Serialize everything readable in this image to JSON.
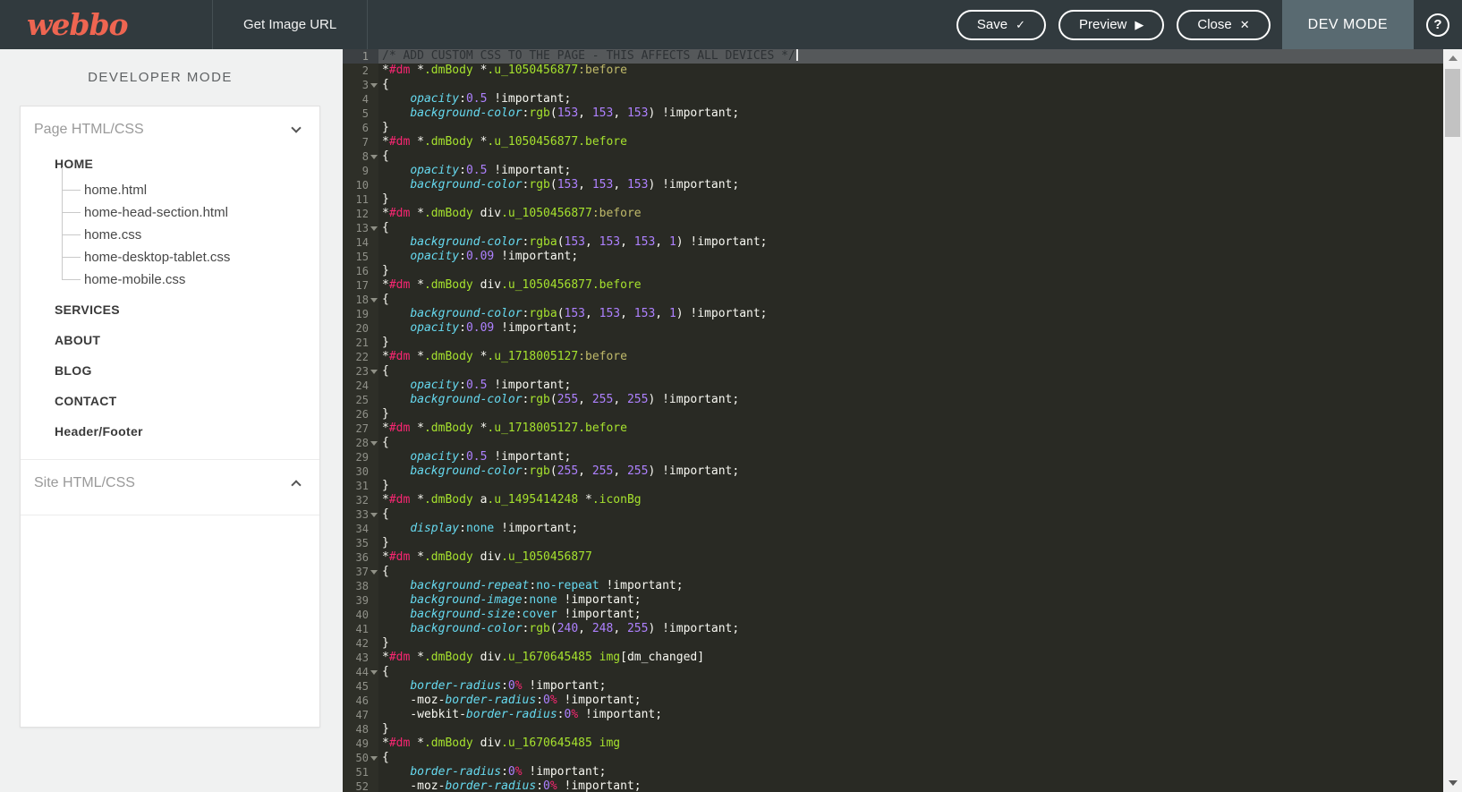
{
  "topbar": {
    "logo": "webbo",
    "get_image_url": "Get Image URL",
    "buttons": [
      {
        "label": "Save",
        "icon": "check-icon",
        "glyph": "✓"
      },
      {
        "label": "Preview",
        "icon": "play-icon",
        "glyph": "▶"
      },
      {
        "label": "Close",
        "icon": "close-icon",
        "glyph": "✕"
      }
    ],
    "dev_mode_label": "DEV MODE",
    "help_glyph": "?"
  },
  "sidebar": {
    "title": "DEVELOPER MODE",
    "page_section_label": "Page HTML/CSS",
    "site_section_label": "Site HTML/CSS",
    "pages": [
      {
        "label": "HOME",
        "files": [
          "home.html",
          "home-head-section.html",
          "home.css",
          "home-desktop-tablet.css",
          "home-mobile.css"
        ]
      },
      {
        "label": "SERVICES",
        "files": []
      },
      {
        "label": "ABOUT",
        "files": []
      },
      {
        "label": "BLOG",
        "files": []
      },
      {
        "label": "CONTACT",
        "files": []
      },
      {
        "label": "Header/Footer",
        "files": []
      }
    ]
  },
  "palette": {
    "brand_orange": "#ee6551",
    "topbar_bg": "#313a3e",
    "devtab_bg": "#596a71",
    "editor_bg": "#292a24",
    "selection_bg": "#55585a",
    "token_white": "#f8f8f2",
    "token_pink": "#f92672",
    "token_green": "#a6e22e",
    "token_olive": "#c0ba6a",
    "token_cyan": "#66d9ef",
    "token_purple": "#ae81ff"
  },
  "editor": {
    "lines": [
      {
        "sel": true,
        "caret": true,
        "t": [
          [
            "c",
            "/* ADD CUSTOM CSS TO THE PAGE - THIS AFFECTS ALL DEVICES */"
          ]
        ]
      },
      {
        "t": [
          [
            "w",
            "*"
          ],
          [
            "p",
            "#dm"
          ],
          [
            "w",
            " *"
          ],
          [
            "g",
            ".dmBody"
          ],
          [
            "w",
            " *"
          ],
          [
            "g",
            ".u_1050456877"
          ],
          [
            "o",
            ":before"
          ]
        ]
      },
      {
        "f": true,
        "t": [
          [
            "w",
            "{"
          ]
        ]
      },
      {
        "t": [
          [
            "w",
            "    "
          ],
          [
            "b",
            "opacity"
          ],
          [
            "w",
            ":"
          ],
          [
            "n",
            "0.5"
          ],
          [
            "w",
            " !important;"
          ]
        ]
      },
      {
        "t": [
          [
            "w",
            "    "
          ],
          [
            "b",
            "background-color"
          ],
          [
            "w",
            ":"
          ],
          [
            "g",
            "rgb"
          ],
          [
            "w",
            "("
          ],
          [
            "n",
            "153"
          ],
          [
            "w",
            ", "
          ],
          [
            "n",
            "153"
          ],
          [
            "w",
            ", "
          ],
          [
            "n",
            "153"
          ],
          [
            "w",
            ") !important;"
          ]
        ]
      },
      {
        "t": [
          [
            "w",
            "}"
          ]
        ]
      },
      {
        "t": [
          [
            "w",
            "*"
          ],
          [
            "p",
            "#dm"
          ],
          [
            "w",
            " *"
          ],
          [
            "g",
            ".dmBody"
          ],
          [
            "w",
            " *"
          ],
          [
            "g",
            ".u_1050456877.before"
          ]
        ]
      },
      {
        "f": true,
        "t": [
          [
            "w",
            "{"
          ]
        ]
      },
      {
        "t": [
          [
            "w",
            "    "
          ],
          [
            "b",
            "opacity"
          ],
          [
            "w",
            ":"
          ],
          [
            "n",
            "0.5"
          ],
          [
            "w",
            " !important;"
          ]
        ]
      },
      {
        "t": [
          [
            "w",
            "    "
          ],
          [
            "b",
            "background-color"
          ],
          [
            "w",
            ":"
          ],
          [
            "g",
            "rgb"
          ],
          [
            "w",
            "("
          ],
          [
            "n",
            "153"
          ],
          [
            "w",
            ", "
          ],
          [
            "n",
            "153"
          ],
          [
            "w",
            ", "
          ],
          [
            "n",
            "153"
          ],
          [
            "w",
            ") !important;"
          ]
        ]
      },
      {
        "t": [
          [
            "w",
            "}"
          ]
        ]
      },
      {
        "t": [
          [
            "w",
            "*"
          ],
          [
            "p",
            "#dm"
          ],
          [
            "w",
            " *"
          ],
          [
            "g",
            ".dmBody"
          ],
          [
            "w",
            " div"
          ],
          [
            "g",
            ".u_1050456877"
          ],
          [
            "o",
            ":before"
          ]
        ]
      },
      {
        "f": true,
        "t": [
          [
            "w",
            "{"
          ]
        ]
      },
      {
        "t": [
          [
            "w",
            "    "
          ],
          [
            "b",
            "background-color"
          ],
          [
            "w",
            ":"
          ],
          [
            "g",
            "rgba"
          ],
          [
            "w",
            "("
          ],
          [
            "n",
            "153"
          ],
          [
            "w",
            ", "
          ],
          [
            "n",
            "153"
          ],
          [
            "w",
            ", "
          ],
          [
            "n",
            "153"
          ],
          [
            "w",
            ", "
          ],
          [
            "n",
            "1"
          ],
          [
            "w",
            ") !important;"
          ]
        ]
      },
      {
        "t": [
          [
            "w",
            "    "
          ],
          [
            "b",
            "opacity"
          ],
          [
            "w",
            ":"
          ],
          [
            "n",
            "0.09"
          ],
          [
            "w",
            " !important;"
          ]
        ]
      },
      {
        "t": [
          [
            "w",
            "}"
          ]
        ]
      },
      {
        "t": [
          [
            "w",
            "*"
          ],
          [
            "p",
            "#dm"
          ],
          [
            "w",
            " *"
          ],
          [
            "g",
            ".dmBody"
          ],
          [
            "w",
            " div"
          ],
          [
            "g",
            ".u_1050456877.before"
          ]
        ]
      },
      {
        "f": true,
        "t": [
          [
            "w",
            "{"
          ]
        ]
      },
      {
        "t": [
          [
            "w",
            "    "
          ],
          [
            "b",
            "background-color"
          ],
          [
            "w",
            ":"
          ],
          [
            "g",
            "rgba"
          ],
          [
            "w",
            "("
          ],
          [
            "n",
            "153"
          ],
          [
            "w",
            ", "
          ],
          [
            "n",
            "153"
          ],
          [
            "w",
            ", "
          ],
          [
            "n",
            "153"
          ],
          [
            "w",
            ", "
          ],
          [
            "n",
            "1"
          ],
          [
            "w",
            ") !important;"
          ]
        ]
      },
      {
        "t": [
          [
            "w",
            "    "
          ],
          [
            "b",
            "opacity"
          ],
          [
            "w",
            ":"
          ],
          [
            "n",
            "0.09"
          ],
          [
            "w",
            " !important;"
          ]
        ]
      },
      {
        "t": [
          [
            "w",
            "}"
          ]
        ]
      },
      {
        "t": [
          [
            "w",
            "*"
          ],
          [
            "p",
            "#dm"
          ],
          [
            "w",
            " *"
          ],
          [
            "g",
            ".dmBody"
          ],
          [
            "w",
            " *"
          ],
          [
            "g",
            ".u_1718005127"
          ],
          [
            "o",
            ":before"
          ]
        ]
      },
      {
        "f": true,
        "t": [
          [
            "w",
            "{"
          ]
        ]
      },
      {
        "t": [
          [
            "w",
            "    "
          ],
          [
            "b",
            "opacity"
          ],
          [
            "w",
            ":"
          ],
          [
            "n",
            "0.5"
          ],
          [
            "w",
            " !important;"
          ]
        ]
      },
      {
        "t": [
          [
            "w",
            "    "
          ],
          [
            "b",
            "background-color"
          ],
          [
            "w",
            ":"
          ],
          [
            "g",
            "rgb"
          ],
          [
            "w",
            "("
          ],
          [
            "n",
            "255"
          ],
          [
            "w",
            ", "
          ],
          [
            "n",
            "255"
          ],
          [
            "w",
            ", "
          ],
          [
            "n",
            "255"
          ],
          [
            "w",
            ") !important;"
          ]
        ]
      },
      {
        "t": [
          [
            "w",
            "}"
          ]
        ]
      },
      {
        "t": [
          [
            "w",
            "*"
          ],
          [
            "p",
            "#dm"
          ],
          [
            "w",
            " *"
          ],
          [
            "g",
            ".dmBody"
          ],
          [
            "w",
            " *"
          ],
          [
            "g",
            ".u_1718005127.before"
          ]
        ]
      },
      {
        "f": true,
        "t": [
          [
            "w",
            "{"
          ]
        ]
      },
      {
        "t": [
          [
            "w",
            "    "
          ],
          [
            "b",
            "opacity"
          ],
          [
            "w",
            ":"
          ],
          [
            "n",
            "0.5"
          ],
          [
            "w",
            " !important;"
          ]
        ]
      },
      {
        "t": [
          [
            "w",
            "    "
          ],
          [
            "b",
            "background-color"
          ],
          [
            "w",
            ":"
          ],
          [
            "g",
            "rgb"
          ],
          [
            "w",
            "("
          ],
          [
            "n",
            "255"
          ],
          [
            "w",
            ", "
          ],
          [
            "n",
            "255"
          ],
          [
            "w",
            ", "
          ],
          [
            "n",
            "255"
          ],
          [
            "w",
            ") !important;"
          ]
        ]
      },
      {
        "t": [
          [
            "w",
            "}"
          ]
        ]
      },
      {
        "t": [
          [
            "w",
            "*"
          ],
          [
            "p",
            "#dm"
          ],
          [
            "w",
            " *"
          ],
          [
            "g",
            ".dmBody"
          ],
          [
            "w",
            " a"
          ],
          [
            "g",
            ".u_1495414248"
          ],
          [
            "w",
            " *"
          ],
          [
            "g",
            ".iconBg"
          ]
        ]
      },
      {
        "f": true,
        "t": [
          [
            "w",
            "{"
          ]
        ]
      },
      {
        "t": [
          [
            "w",
            "    "
          ],
          [
            "b",
            "display"
          ],
          [
            "w",
            ":"
          ],
          [
            "k",
            "none"
          ],
          [
            "w",
            " !important;"
          ]
        ]
      },
      {
        "t": [
          [
            "w",
            "}"
          ]
        ]
      },
      {
        "t": [
          [
            "w",
            "*"
          ],
          [
            "p",
            "#dm"
          ],
          [
            "w",
            " *"
          ],
          [
            "g",
            ".dmBody"
          ],
          [
            "w",
            " div"
          ],
          [
            "g",
            ".u_1050456877"
          ]
        ]
      },
      {
        "f": true,
        "t": [
          [
            "w",
            "{"
          ]
        ]
      },
      {
        "t": [
          [
            "w",
            "    "
          ],
          [
            "b",
            "background-repeat"
          ],
          [
            "w",
            ":"
          ],
          [
            "k",
            "no-repeat"
          ],
          [
            "w",
            " !important;"
          ]
        ]
      },
      {
        "t": [
          [
            "w",
            "    "
          ],
          [
            "b",
            "background-image"
          ],
          [
            "w",
            ":"
          ],
          [
            "k",
            "none"
          ],
          [
            "w",
            " !important;"
          ]
        ]
      },
      {
        "t": [
          [
            "w",
            "    "
          ],
          [
            "b",
            "background-size"
          ],
          [
            "w",
            ":"
          ],
          [
            "k",
            "cover"
          ],
          [
            "w",
            " !important;"
          ]
        ]
      },
      {
        "t": [
          [
            "w",
            "    "
          ],
          [
            "b",
            "background-color"
          ],
          [
            "w",
            ":"
          ],
          [
            "g",
            "rgb"
          ],
          [
            "w",
            "("
          ],
          [
            "n",
            "240"
          ],
          [
            "w",
            ", "
          ],
          [
            "n",
            "248"
          ],
          [
            "w",
            ", "
          ],
          [
            "n",
            "255"
          ],
          [
            "w",
            ") !important;"
          ]
        ]
      },
      {
        "t": [
          [
            "w",
            "}"
          ]
        ]
      },
      {
        "t": [
          [
            "w",
            "*"
          ],
          [
            "p",
            "#dm"
          ],
          [
            "w",
            " *"
          ],
          [
            "g",
            ".dmBody"
          ],
          [
            "w",
            " div"
          ],
          [
            "g",
            ".u_1670645485"
          ],
          [
            "w",
            " "
          ],
          [
            "g",
            "img"
          ],
          [
            "w",
            "[dm_changed]"
          ]
        ]
      },
      {
        "f": true,
        "t": [
          [
            "w",
            "{"
          ]
        ]
      },
      {
        "t": [
          [
            "w",
            "    "
          ],
          [
            "b",
            "border-radius"
          ],
          [
            "w",
            ":"
          ],
          [
            "n",
            "0"
          ],
          [
            "p",
            "%"
          ],
          [
            "w",
            " !important;"
          ]
        ]
      },
      {
        "t": [
          [
            "w",
            "    -moz-"
          ],
          [
            "b",
            "border-radius"
          ],
          [
            "w",
            ":"
          ],
          [
            "n",
            "0"
          ],
          [
            "p",
            "%"
          ],
          [
            "w",
            " !important;"
          ]
        ]
      },
      {
        "t": [
          [
            "w",
            "    -webkit-"
          ],
          [
            "b",
            "border-radius"
          ],
          [
            "w",
            ":"
          ],
          [
            "n",
            "0"
          ],
          [
            "p",
            "%"
          ],
          [
            "w",
            " !important;"
          ]
        ]
      },
      {
        "t": [
          [
            "w",
            "}"
          ]
        ]
      },
      {
        "t": [
          [
            "w",
            "*"
          ],
          [
            "p",
            "#dm"
          ],
          [
            "w",
            " *"
          ],
          [
            "g",
            ".dmBody"
          ],
          [
            "w",
            " div"
          ],
          [
            "g",
            ".u_1670645485"
          ],
          [
            "w",
            " "
          ],
          [
            "g",
            "img"
          ]
        ]
      },
      {
        "f": true,
        "t": [
          [
            "w",
            "{"
          ]
        ]
      },
      {
        "t": [
          [
            "w",
            "    "
          ],
          [
            "b",
            "border-radius"
          ],
          [
            "w",
            ":"
          ],
          [
            "n",
            "0"
          ],
          [
            "p",
            "%"
          ],
          [
            "w",
            " !important;"
          ]
        ]
      },
      {
        "t": [
          [
            "w",
            "    -moz-"
          ],
          [
            "b",
            "border-radius"
          ],
          [
            "w",
            ":"
          ],
          [
            "n",
            "0"
          ],
          [
            "p",
            "%"
          ],
          [
            "w",
            " !important;"
          ]
        ]
      }
    ]
  }
}
